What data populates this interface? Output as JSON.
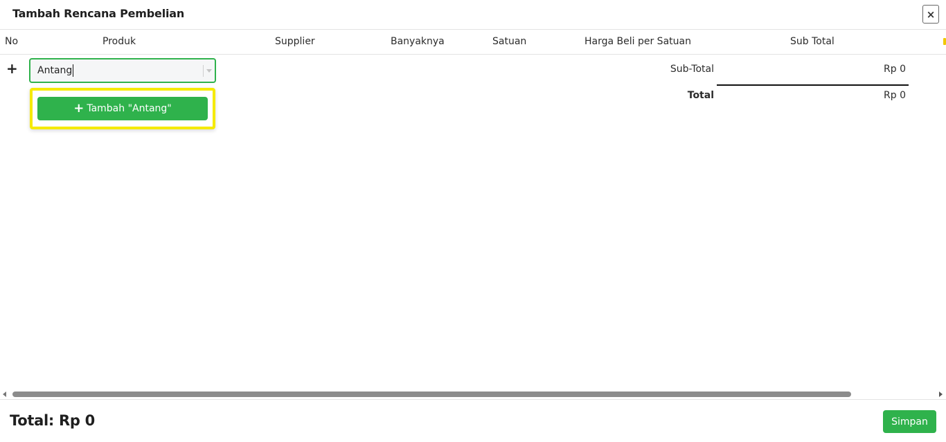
{
  "modal": {
    "title": "Tambah Rencana Pembelian",
    "close_label": "×"
  },
  "table": {
    "columns": [
      "No",
      "Produk",
      "Supplier",
      "Banyaknya",
      "Satuan",
      "Harga Beli per Satuan",
      "Sub Total"
    ]
  },
  "row": {
    "add_icon": "+",
    "product_input_value": "Antang",
    "dropdown_add_label": "Tambah \"Antang\"",
    "dropdown_add_icon": "+"
  },
  "summary": {
    "subtotal_label": "Sub-Total",
    "subtotal_value": "Rp 0",
    "total_label": "Total",
    "total_value": "Rp 0"
  },
  "footer": {
    "total_text": "Total: Rp 0",
    "save_label": "Simpan"
  },
  "colors": {
    "accent_green": "#2fb24c",
    "highlight_yellow": "#f5ea00"
  }
}
